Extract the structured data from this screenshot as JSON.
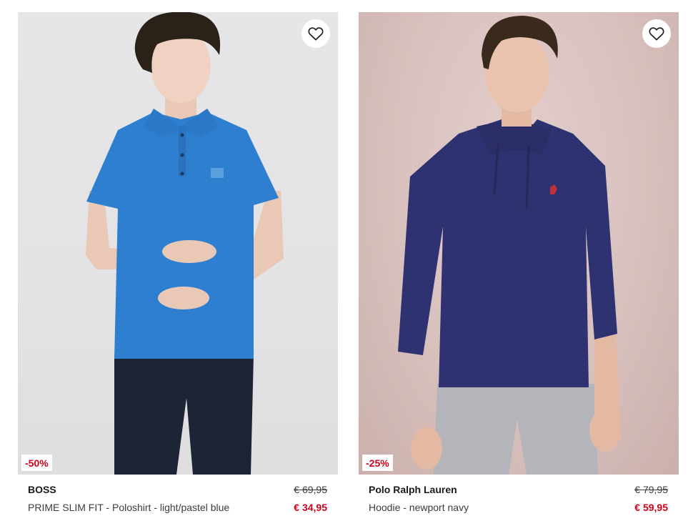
{
  "products": [
    {
      "brand": "BOSS",
      "name": "PRIME SLIM FIT - Poloshirt - light/pastel blue",
      "discount": "-50%",
      "old_price": "€ 69,95",
      "price": "€ 34,95",
      "image_icon": "model-photo",
      "wishlist_icon": "heart-outline-icon"
    },
    {
      "brand": "Polo Ralph Lauren",
      "name": "Hoodie - newport navy",
      "discount": "-25%",
      "old_price": "€ 79,95",
      "price": "€ 59,95",
      "image_icon": "model-photo",
      "wishlist_icon": "heart-outline-icon"
    }
  ],
  "colors": {
    "sale_red": "#d0021b",
    "polo_blue": "#2f7fd1",
    "hoodie_navy": "#2f3270"
  }
}
